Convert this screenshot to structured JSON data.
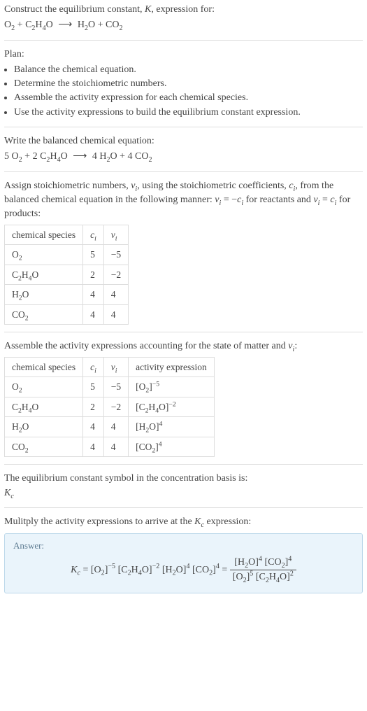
{
  "intro": {
    "line1_a": "Construct the equilibrium constant, ",
    "line1_K": "K",
    "line1_b": ", expression for:",
    "reaction_lhs1": "O",
    "reaction_lhs1_sub": "2",
    "reaction_plus": " + ",
    "reaction_lhs2": "C",
    "reaction_lhs2_sub1": "2",
    "reaction_lhs2_mid": "H",
    "reaction_lhs2_sub2": "4",
    "reaction_lhs2_end": "O",
    "reaction_arrow": "⟶",
    "reaction_rhs1": "H",
    "reaction_rhs1_sub": "2",
    "reaction_rhs1_end": "O",
    "reaction_rhs2": "CO",
    "reaction_rhs2_sub": "2"
  },
  "plan": {
    "label": "Plan:",
    "items": [
      "Balance the chemical equation.",
      "Determine the stoichiometric numbers.",
      "Assemble the activity expression for each chemical species.",
      "Use the activity expressions to build the equilibrium constant expression."
    ]
  },
  "balanced": {
    "label": "Write the balanced chemical equation:",
    "c1": "5 ",
    "s1a": "O",
    "s1sub": "2",
    "plus1": " + ",
    "c2": "2 ",
    "s2a": "C",
    "s2s1": "2",
    "s2b": "H",
    "s2s2": "4",
    "s2c": "O",
    "arrow": "⟶",
    "c3": " 4 ",
    "s3a": "H",
    "s3sub": "2",
    "s3b": "O",
    "plus2": " + ",
    "c4": "4 ",
    "s4a": "CO",
    "s4sub": "2"
  },
  "assign": {
    "text_a": "Assign stoichiometric numbers, ",
    "nu": "ν",
    "i": "i",
    "text_b": ", using the stoichiometric coefficients, ",
    "c": "c",
    "text_c": ", from the balanced chemical equation in the following manner: ",
    "rel1a": "ν",
    "rel1b": " = −",
    "rel1c": "c",
    "text_d": " for reactants and ",
    "rel2a": "ν",
    "rel2b": " = ",
    "rel2c": "c",
    "text_e": " for products:"
  },
  "table1": {
    "h1": "chemical species",
    "h2c": "c",
    "h2i": "i",
    "h3n": "ν",
    "h3i": "i",
    "rows": [
      {
        "sp_a": "O",
        "sp_s1": "2",
        "sp_b": "",
        "sp_s2": "",
        "sp_c": "",
        "c": "5",
        "nu": "−5"
      },
      {
        "sp_a": "C",
        "sp_s1": "2",
        "sp_b": "H",
        "sp_s2": "4",
        "sp_c": "O",
        "c": "2",
        "nu": "−2"
      },
      {
        "sp_a": "H",
        "sp_s1": "2",
        "sp_b": "O",
        "sp_s2": "",
        "sp_c": "",
        "c": "4",
        "nu": "4"
      },
      {
        "sp_a": "CO",
        "sp_s1": "2",
        "sp_b": "",
        "sp_s2": "",
        "sp_c": "",
        "c": "4",
        "nu": "4"
      }
    ]
  },
  "assemble": {
    "text_a": "Assemble the activity expressions accounting for the state of matter and ",
    "nu": "ν",
    "i": "i",
    "text_b": ":"
  },
  "table2": {
    "h1": "chemical species",
    "h2c": "c",
    "h2i": "i",
    "h3n": "ν",
    "h3i": "i",
    "h4": "activity expression",
    "rows": [
      {
        "sp_a": "O",
        "sp_s1": "2",
        "sp_b": "",
        "sp_s2": "",
        "sp_c": "",
        "c": "5",
        "nu": "−5",
        "ae_a": "[O",
        "ae_s": "2",
        "ae_b": "]",
        "ae_e": "−5"
      },
      {
        "sp_a": "C",
        "sp_s1": "2",
        "sp_b": "H",
        "sp_s2": "4",
        "sp_c": "O",
        "c": "2",
        "nu": "−2",
        "ae_a": "[C",
        "ae_s": "2",
        "ae_b": "H",
        "ae_s2": "4",
        "ae_c": "O]",
        "ae_e": "−2"
      },
      {
        "sp_a": "H",
        "sp_s1": "2",
        "sp_b": "O",
        "sp_s2": "",
        "sp_c": "",
        "c": "4",
        "nu": "4",
        "ae_a": "[H",
        "ae_s": "2",
        "ae_b": "O]",
        "ae_e": "4"
      },
      {
        "sp_a": "CO",
        "sp_s1": "2",
        "sp_b": "",
        "sp_s2": "",
        "sp_c": "",
        "c": "4",
        "nu": "4",
        "ae_a": "[CO",
        "ae_s": "2",
        "ae_b": "]",
        "ae_e": "4"
      }
    ]
  },
  "symbol": {
    "text": "The equilibrium constant symbol in the concentration basis is:",
    "K": "K",
    "c": "c"
  },
  "multiply": {
    "text_a": "Mulitply the activity expressions to arrive at the ",
    "K": "K",
    "c": "c",
    "text_b": " expression:"
  },
  "answer": {
    "label": "Answer:",
    "K": "K",
    "c": "c",
    "eq": " = ",
    "t1a": "[O",
    "t1s": "2",
    "t1b": "]",
    "t1e": "−5",
    "t2a": "[C",
    "t2s1": "2",
    "t2b": "H",
    "t2s2": "4",
    "t2c": "O]",
    "t2e": "−2",
    "t3a": "[H",
    "t3s": "2",
    "t3b": "O]",
    "t3e": "4",
    "t4a": "[CO",
    "t4s": "2",
    "t4b": "]",
    "t4e": "4",
    "eq2": " = ",
    "num1a": "[H",
    "num1s": "2",
    "num1b": "O]",
    "num1e": "4",
    "num2a": "[CO",
    "num2s": "2",
    "num2b": "]",
    "num2e": "4",
    "den1a": "[O",
    "den1s": "2",
    "den1b": "]",
    "den1e": "5",
    "den2a": "[C",
    "den2s1": "2",
    "den2b": "H",
    "den2s2": "4",
    "den2c": "O]",
    "den2e": "2"
  }
}
